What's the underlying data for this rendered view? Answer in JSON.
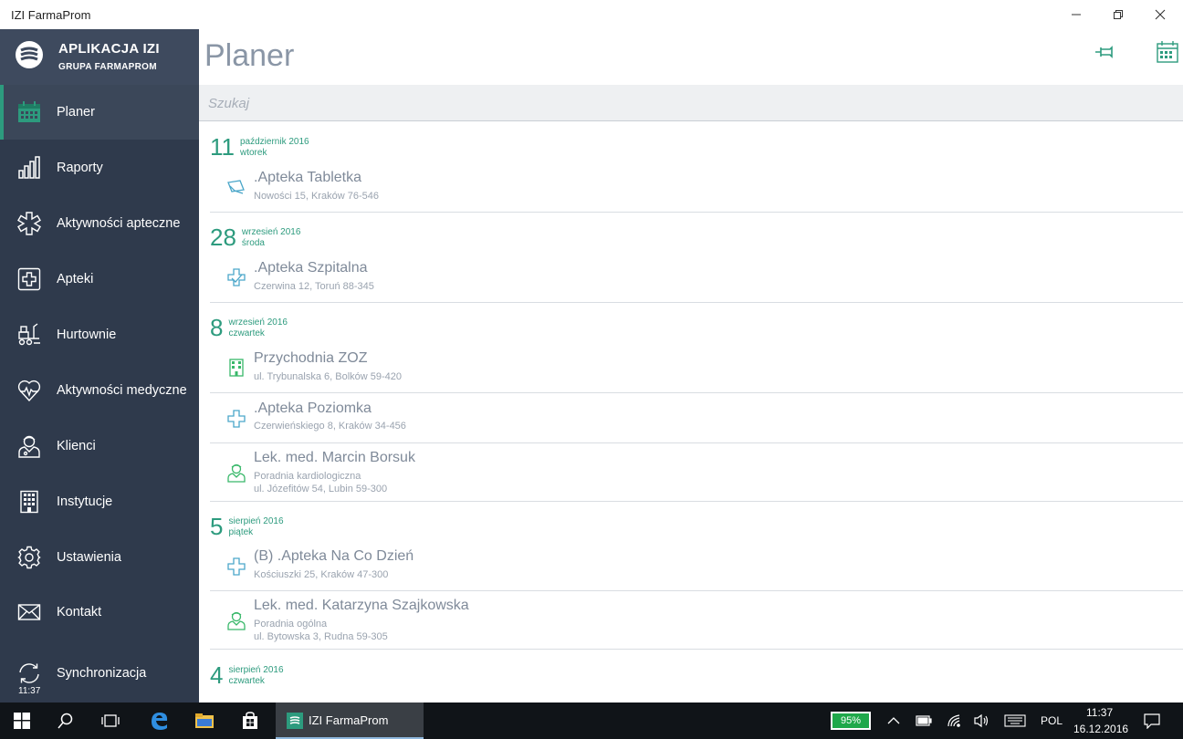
{
  "window": {
    "title": "IZI FarmaProm"
  },
  "sidebar": {
    "app_name": "APLIKACJA IZI",
    "app_subtitle": "GRUPA FARMAPROM",
    "items": [
      {
        "label": "Planer",
        "icon": "calendar-icon",
        "active": true
      },
      {
        "label": "Raporty",
        "icon": "bar-chart-icon",
        "active": false
      },
      {
        "label": "Aktywności apteczne",
        "icon": "asterisk-medical-icon",
        "active": false
      },
      {
        "label": "Apteki",
        "icon": "pharmacy-cross-icon",
        "active": false
      },
      {
        "label": "Hurtownie",
        "icon": "forklift-icon",
        "active": false
      },
      {
        "label": "Aktywności medyczne",
        "icon": "heart-pulse-icon",
        "active": false
      },
      {
        "label": "Klienci",
        "icon": "doctor-icon",
        "active": false
      },
      {
        "label": "Instytucje",
        "icon": "building-icon",
        "active": false
      },
      {
        "label": "Ustawienia",
        "icon": "gear-icon",
        "active": false
      },
      {
        "label": "Kontakt",
        "icon": "envelope-icon",
        "active": false
      },
      {
        "label": "Synchronizacja",
        "icon": "sync-icon",
        "active": false
      }
    ],
    "sync_time": "11:37"
  },
  "main": {
    "title": "Planer",
    "search_placeholder": "Szukaj",
    "groups": [
      {
        "day": "11",
        "month_year": "październik 2016",
        "weekday": "wtorek",
        "entries": [
          {
            "icon": "prescription-icon",
            "name": ".Apteka Tabletka",
            "lines": [
              "Nowości 15, Kraków 76-546"
            ]
          }
        ]
      },
      {
        "day": "28",
        "month_year": "wrzesień 2016",
        "weekday": "środa",
        "entries": [
          {
            "icon": "hospital-cross-icon",
            "name": ".Apteka Szpitalna",
            "lines": [
              "Czerwina 12, Toruń 88-345"
            ]
          }
        ]
      },
      {
        "day": "8",
        "month_year": "wrzesień 2016",
        "weekday": "czwartek",
        "entries": [
          {
            "icon": "clinic-building-icon",
            "name": "Przychodnia ZOZ",
            "lines": [
              "ul. Trybunalska 6, Bolków 59-420"
            ]
          },
          {
            "icon": "pharmacy-cross-icon",
            "name": ".Apteka Poziomka",
            "lines": [
              "Czerwieńskiego 8, Kraków 34-456"
            ]
          },
          {
            "icon": "doctor-icon",
            "name": "Lek. med. Marcin Borsuk",
            "lines": [
              "Poradnia kardiologiczna",
              "ul. Józefitów 54, Lubin 59-300"
            ]
          }
        ]
      },
      {
        "day": "5",
        "month_year": "sierpień 2016",
        "weekday": "piątek",
        "entries": [
          {
            "icon": "pharmacy-cross-icon",
            "name": "(B) .Apteka Na Co Dzień",
            "lines": [
              "Kościuszki 25, Kraków 47-300"
            ]
          },
          {
            "icon": "doctor-icon",
            "name": "Lek. med. Katarzyna Szajkowska",
            "lines": [
              "Poradnia ogólna",
              "ul. Bytowska 3, Rudna 59-305"
            ]
          }
        ]
      },
      {
        "day": "4",
        "month_year": "sierpień 2016",
        "weekday": "czwartek",
        "entries": []
      }
    ]
  },
  "taskbar": {
    "app_label": "IZI FarmaProm",
    "battery": "95%",
    "language": "POL",
    "time": "11:37",
    "date": "16.12.2016"
  },
  "colors": {
    "accent": "#2d9b7e",
    "sidebar": "#2f3a4c",
    "taskbar": "#101418"
  }
}
